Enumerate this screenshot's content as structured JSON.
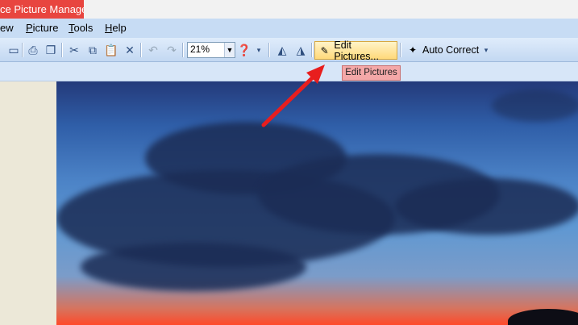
{
  "window": {
    "title": "ce Picture Manager"
  },
  "menu": [
    {
      "label": "ew",
      "underline": "",
      "rest": "ew"
    },
    {
      "label": "Picture",
      "underline": "P",
      "rest": "icture"
    },
    {
      "label": "Tools",
      "underline": "T",
      "rest": "ools"
    },
    {
      "label": "Help",
      "underline": "H",
      "rest": "elp"
    }
  ],
  "toolbar": {
    "zoom_value": "21%",
    "edit_pictures_label": "Edit Pictures...",
    "auto_correct_label": "Auto Correct"
  },
  "tooltip": {
    "text": "Edit Pictures"
  },
  "colors": {
    "title_bg": "#e8453f",
    "menu_bg": "#c7dcf4",
    "highlight": "#ffd97a",
    "tooltip_bg": "#f4a8a8",
    "arrow": "#e81e1e"
  }
}
